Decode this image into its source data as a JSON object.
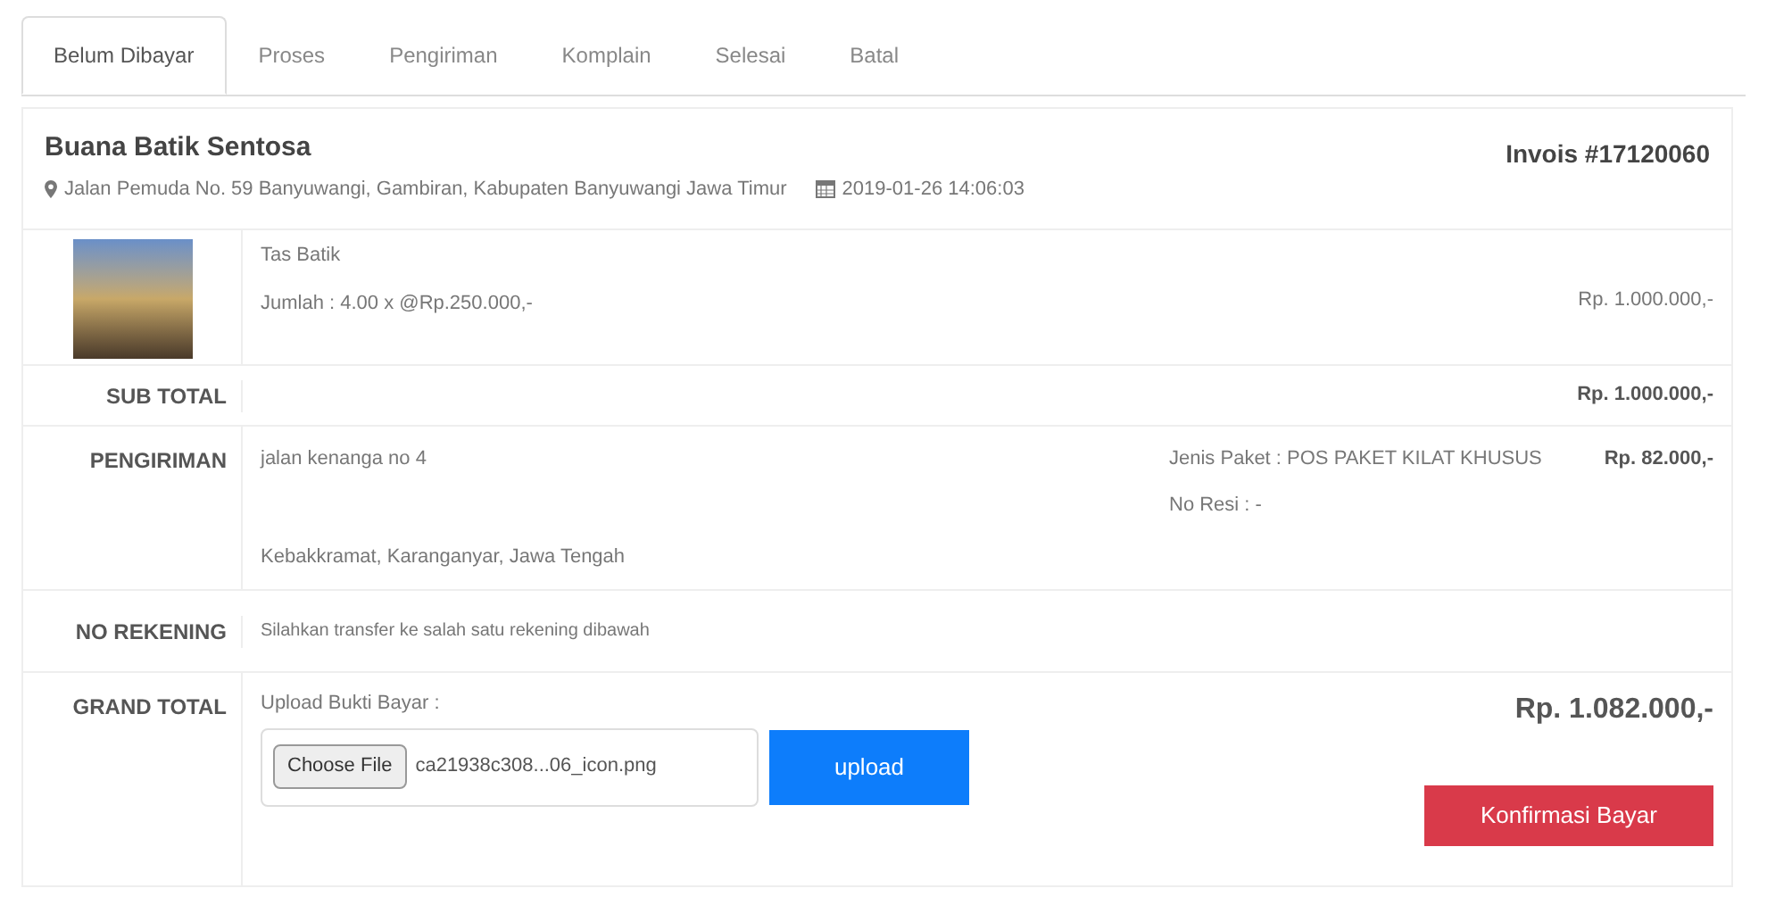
{
  "tabs": [
    {
      "label": "Belum Dibayar",
      "selected": true
    },
    {
      "label": "Proses",
      "selected": false
    },
    {
      "label": "Pengiriman",
      "selected": false
    },
    {
      "label": "Komplain",
      "selected": false
    },
    {
      "label": "Selesai",
      "selected": false
    },
    {
      "label": "Batal",
      "selected": false
    }
  ],
  "order": {
    "shop": "Buana Batik Sentosa",
    "invoice": "Invois #17120060",
    "address": "Jalan Pemuda No. 59 Banyuwangi, Gambiran, Kabupaten Banyuwangi Jawa Timur",
    "date": "2019-01-26 14:06:03"
  },
  "item": {
    "name": "Tas Batik",
    "quantity": "Jumlah : 4.00 x @Rp.250.000,-",
    "price": "Rp. 1.000.000,-"
  },
  "subtotal": {
    "label": "SUB TOTAL",
    "value": "Rp. 1.000.000,-"
  },
  "shipping": {
    "label": "PENGIRIMAN",
    "street": "jalan kenanga no 4",
    "region": "Kebakkramat, Karanganyar, Jawa Tengah",
    "package": "Jenis Paket : POS PAKET KILAT KHUSUS",
    "receipt": "No Resi : -",
    "cost": "Rp. 82.000,-"
  },
  "account": {
    "label": "NO REKENING",
    "note": "Silahkan transfer ke salah satu rekening dibawah"
  },
  "grand_total": {
    "label": "GRAND TOTAL",
    "upload_label": "Upload Bukti Bayar :",
    "choose_button": "Choose File",
    "file_name": "ca21938c308...06_icon.png",
    "upload_button": "upload",
    "value": "Rp. 1.082.000,-",
    "confirm_button": "Konfirmasi Bayar"
  }
}
